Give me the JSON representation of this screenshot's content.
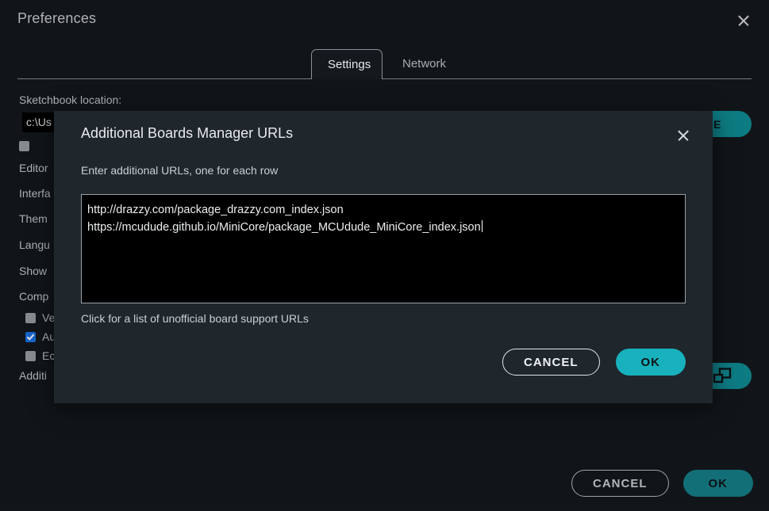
{
  "window": {
    "title": "Preferences",
    "close_icon": "close-icon"
  },
  "tabs": [
    {
      "label": "Settings",
      "active": true
    },
    {
      "label": "Network",
      "active": false
    }
  ],
  "settings": {
    "sketchbook_label": "Sketchbook location:",
    "sketchbook_value": "c:\\Us",
    "browse_label": "SE",
    "rows": [
      {
        "label": "Editor"
      },
      {
        "label": "Interfa"
      },
      {
        "label": "Them"
      },
      {
        "label": "Langu"
      },
      {
        "label": "Show"
      },
      {
        "label": "Comp"
      }
    ],
    "checkboxes": [
      {
        "label": "Ve",
        "checked": false
      },
      {
        "label": "Au",
        "checked": true
      },
      {
        "label": "Ec",
        "checked": false
      }
    ],
    "additional_label": "Additi",
    "boards_url_icon": "windows-copy-icon"
  },
  "footer": {
    "cancel_label": "CANCEL",
    "ok_label": "OK"
  },
  "modal": {
    "title": "Additional Boards Manager URLs",
    "close_icon": "close-icon",
    "subtitle": "Enter additional URLs, one for each row",
    "urls": [
      "http://drazzy.com/package_drazzy.com_index.json",
      "https://mcudude.github.io/MiniCore/package_MCUdude_MiniCore_index.json"
    ],
    "hint": "Click for a list of unofficial board support URLs",
    "cancel_label": "CANCEL",
    "ok_label": "OK"
  },
  "colors": {
    "background": "#14191d",
    "panel": "#1f262c",
    "accent_teal": "#17b2bd",
    "accent_teal_dim": "#0f8e96",
    "checkbox_checked": "#1a73e8",
    "text": "#dadce0"
  }
}
